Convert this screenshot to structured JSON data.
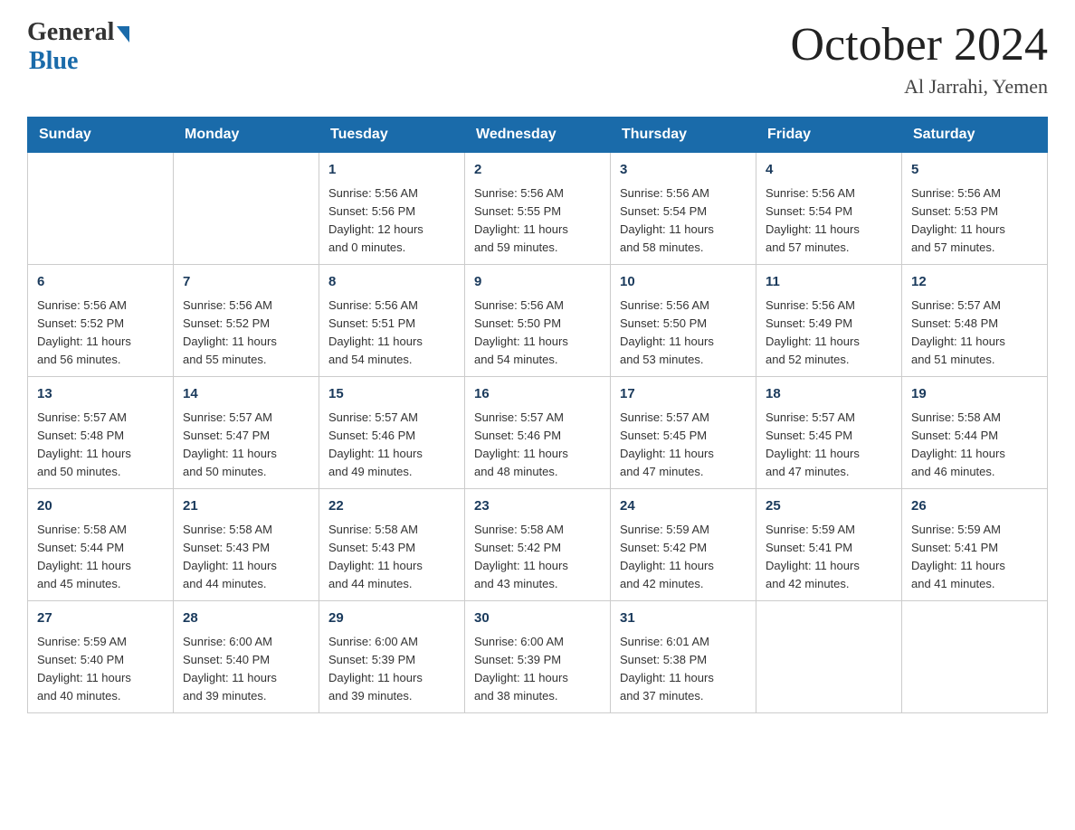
{
  "logo": {
    "general": "General",
    "blue": "Blue"
  },
  "title": "October 2024",
  "subtitle": "Al Jarrahi, Yemen",
  "headers": [
    "Sunday",
    "Monday",
    "Tuesday",
    "Wednesday",
    "Thursday",
    "Friday",
    "Saturday"
  ],
  "weeks": [
    [
      {
        "day": "",
        "info": ""
      },
      {
        "day": "",
        "info": ""
      },
      {
        "day": "1",
        "info": "Sunrise: 5:56 AM\nSunset: 5:56 PM\nDaylight: 12 hours\nand 0 minutes."
      },
      {
        "day": "2",
        "info": "Sunrise: 5:56 AM\nSunset: 5:55 PM\nDaylight: 11 hours\nand 59 minutes."
      },
      {
        "day": "3",
        "info": "Sunrise: 5:56 AM\nSunset: 5:54 PM\nDaylight: 11 hours\nand 58 minutes."
      },
      {
        "day": "4",
        "info": "Sunrise: 5:56 AM\nSunset: 5:54 PM\nDaylight: 11 hours\nand 57 minutes."
      },
      {
        "day": "5",
        "info": "Sunrise: 5:56 AM\nSunset: 5:53 PM\nDaylight: 11 hours\nand 57 minutes."
      }
    ],
    [
      {
        "day": "6",
        "info": "Sunrise: 5:56 AM\nSunset: 5:52 PM\nDaylight: 11 hours\nand 56 minutes."
      },
      {
        "day": "7",
        "info": "Sunrise: 5:56 AM\nSunset: 5:52 PM\nDaylight: 11 hours\nand 55 minutes."
      },
      {
        "day": "8",
        "info": "Sunrise: 5:56 AM\nSunset: 5:51 PM\nDaylight: 11 hours\nand 54 minutes."
      },
      {
        "day": "9",
        "info": "Sunrise: 5:56 AM\nSunset: 5:50 PM\nDaylight: 11 hours\nand 54 minutes."
      },
      {
        "day": "10",
        "info": "Sunrise: 5:56 AM\nSunset: 5:50 PM\nDaylight: 11 hours\nand 53 minutes."
      },
      {
        "day": "11",
        "info": "Sunrise: 5:56 AM\nSunset: 5:49 PM\nDaylight: 11 hours\nand 52 minutes."
      },
      {
        "day": "12",
        "info": "Sunrise: 5:57 AM\nSunset: 5:48 PM\nDaylight: 11 hours\nand 51 minutes."
      }
    ],
    [
      {
        "day": "13",
        "info": "Sunrise: 5:57 AM\nSunset: 5:48 PM\nDaylight: 11 hours\nand 50 minutes."
      },
      {
        "day": "14",
        "info": "Sunrise: 5:57 AM\nSunset: 5:47 PM\nDaylight: 11 hours\nand 50 minutes."
      },
      {
        "day": "15",
        "info": "Sunrise: 5:57 AM\nSunset: 5:46 PM\nDaylight: 11 hours\nand 49 minutes."
      },
      {
        "day": "16",
        "info": "Sunrise: 5:57 AM\nSunset: 5:46 PM\nDaylight: 11 hours\nand 48 minutes."
      },
      {
        "day": "17",
        "info": "Sunrise: 5:57 AM\nSunset: 5:45 PM\nDaylight: 11 hours\nand 47 minutes."
      },
      {
        "day": "18",
        "info": "Sunrise: 5:57 AM\nSunset: 5:45 PM\nDaylight: 11 hours\nand 47 minutes."
      },
      {
        "day": "19",
        "info": "Sunrise: 5:58 AM\nSunset: 5:44 PM\nDaylight: 11 hours\nand 46 minutes."
      }
    ],
    [
      {
        "day": "20",
        "info": "Sunrise: 5:58 AM\nSunset: 5:44 PM\nDaylight: 11 hours\nand 45 minutes."
      },
      {
        "day": "21",
        "info": "Sunrise: 5:58 AM\nSunset: 5:43 PM\nDaylight: 11 hours\nand 44 minutes."
      },
      {
        "day": "22",
        "info": "Sunrise: 5:58 AM\nSunset: 5:43 PM\nDaylight: 11 hours\nand 44 minutes."
      },
      {
        "day": "23",
        "info": "Sunrise: 5:58 AM\nSunset: 5:42 PM\nDaylight: 11 hours\nand 43 minutes."
      },
      {
        "day": "24",
        "info": "Sunrise: 5:59 AM\nSunset: 5:42 PM\nDaylight: 11 hours\nand 42 minutes."
      },
      {
        "day": "25",
        "info": "Sunrise: 5:59 AM\nSunset: 5:41 PM\nDaylight: 11 hours\nand 42 minutes."
      },
      {
        "day": "26",
        "info": "Sunrise: 5:59 AM\nSunset: 5:41 PM\nDaylight: 11 hours\nand 41 minutes."
      }
    ],
    [
      {
        "day": "27",
        "info": "Sunrise: 5:59 AM\nSunset: 5:40 PM\nDaylight: 11 hours\nand 40 minutes."
      },
      {
        "day": "28",
        "info": "Sunrise: 6:00 AM\nSunset: 5:40 PM\nDaylight: 11 hours\nand 39 minutes."
      },
      {
        "day": "29",
        "info": "Sunrise: 6:00 AM\nSunset: 5:39 PM\nDaylight: 11 hours\nand 39 minutes."
      },
      {
        "day": "30",
        "info": "Sunrise: 6:00 AM\nSunset: 5:39 PM\nDaylight: 11 hours\nand 38 minutes."
      },
      {
        "day": "31",
        "info": "Sunrise: 6:01 AM\nSunset: 5:38 PM\nDaylight: 11 hours\nand 37 minutes."
      },
      {
        "day": "",
        "info": ""
      },
      {
        "day": "",
        "info": ""
      }
    ]
  ]
}
